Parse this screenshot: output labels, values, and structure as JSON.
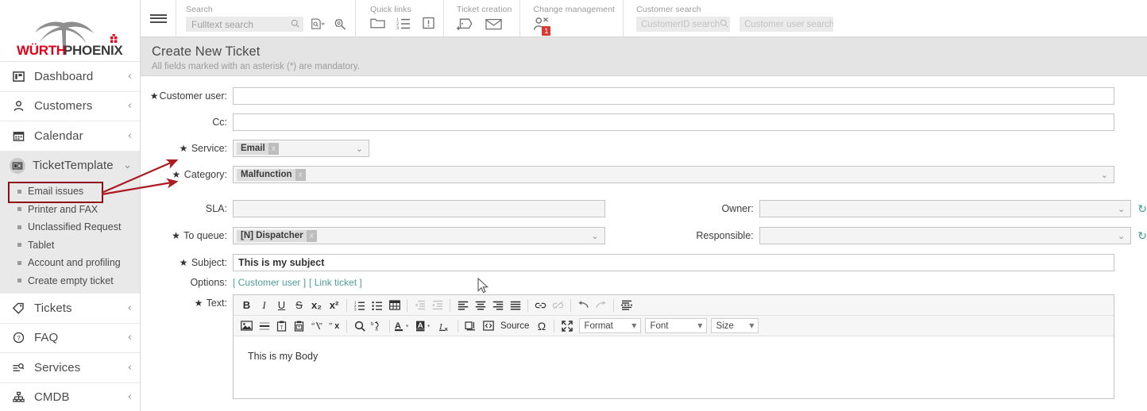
{
  "brand": {
    "name_part1": "WÜRTH",
    "name_part2": "PHOENIX",
    "red": "#e2001a",
    "grey": "#8e8e8e"
  },
  "sidebar": {
    "items": [
      {
        "label": "Dashboard",
        "icon": "dashboard-icon",
        "chevron": "‹"
      },
      {
        "label": "Customers",
        "icon": "user-icon",
        "chevron": "‹"
      },
      {
        "label": "Calendar",
        "icon": "calendar-icon",
        "chevron": "‹"
      },
      {
        "label": "TicketTemplate",
        "icon": "template-icon",
        "chevron": "⌄"
      },
      {
        "label": "Tickets",
        "icon": "tag-icon",
        "chevron": "‹"
      },
      {
        "label": "FAQ",
        "icon": "question-icon",
        "chevron": "‹"
      },
      {
        "label": "Services",
        "icon": "service-search-icon",
        "chevron": "‹"
      },
      {
        "label": "CMDB",
        "icon": "hierarchy-icon",
        "chevron": "‹"
      }
    ],
    "sub_items": [
      {
        "label": "Email issues",
        "highlighted": true
      },
      {
        "label": "Printer and FAX",
        "highlighted": false
      },
      {
        "label": "Unclassified Request",
        "highlighted": false
      },
      {
        "label": "Tablet",
        "highlighted": false
      },
      {
        "label": "Account and profiling",
        "highlighted": false
      },
      {
        "label": "Create empty ticket",
        "highlighted": false
      }
    ],
    "highlight_color": "#8b0f14"
  },
  "toolbar": {
    "menu_icon": "hamburger-icon",
    "search": {
      "title": "Search",
      "placeholder": "Fulltext search",
      "icons": [
        "search-icon",
        "search-document-dropdown-icon",
        "search-advanced-icon"
      ]
    },
    "quick_links": {
      "title": "Quick links",
      "icons": [
        "folder-icon",
        "list-icon",
        "alert-icon"
      ]
    },
    "ticket_creation": {
      "title": "Ticket creation",
      "icons": [
        "ticket-add-icon",
        "email-icon"
      ]
    },
    "change_management": {
      "title": "Change management",
      "icon": "change-user-icon",
      "badge": "1",
      "badge_color": "#d93a34"
    },
    "customer_search": {
      "title": "Customer search",
      "field1_placeholder": "CustomerID search",
      "field2_placeholder": "Customer user search",
      "icon": "search-icon"
    }
  },
  "page": {
    "title": "Create New Ticket",
    "subtitle": "All fields marked with an asterisk (*) are mandatory."
  },
  "form": {
    "star": "★",
    "fields": {
      "customer_user": {
        "label": "Customer user:",
        "required": true,
        "value": ""
      },
      "cc": {
        "label": "Cc:",
        "required": false,
        "value": ""
      },
      "service": {
        "label": "Service:",
        "required": true,
        "tag": "Email",
        "tag_remove": "x"
      },
      "category": {
        "label": "Category:",
        "required": true,
        "tag": "Malfunction",
        "tag_remove": "x"
      },
      "sla": {
        "label": "SLA:",
        "required": false,
        "value": ""
      },
      "to_queue": {
        "label": "To queue:",
        "required": true,
        "tag": "[N] Dispatcher",
        "tag_remove": "x"
      },
      "subject": {
        "label": "Subject:",
        "required": true,
        "value": "This is my subject"
      },
      "options": {
        "label": "Options:",
        "required": false,
        "link1": "[ Customer user ]",
        "link2": "[ Link ticket ]"
      },
      "text": {
        "label": "Text:",
        "required": true,
        "body": "This is my Body"
      },
      "owner": {
        "label": "Owner:",
        "required": false,
        "value": ""
      },
      "responsible": {
        "label": "Responsible:",
        "required": false,
        "value": ""
      }
    },
    "link_color": "#4f9e98",
    "refresh_color": "#3f9a93"
  },
  "editor": {
    "row1": [
      {
        "name": "bold-icon",
        "glyph": "B",
        "style": "bold"
      },
      {
        "name": "italic-icon",
        "glyph": "I",
        "style": "italic"
      },
      {
        "name": "underline-icon",
        "glyph": "U",
        "style": "underline"
      },
      {
        "name": "strikethrough-icon",
        "glyph": "S",
        "style": "strike"
      },
      {
        "name": "subscript-icon",
        "glyph": "x₂",
        "style": "plain"
      },
      {
        "name": "superscript-icon",
        "glyph": "x²",
        "style": "plain"
      },
      {
        "name": "numbered-list-icon",
        "glyph": "svg",
        "style": "plain"
      },
      {
        "name": "bulleted-list-icon",
        "glyph": "svg",
        "style": "plain"
      },
      {
        "name": "table-icon",
        "glyph": "svg",
        "style": "plain"
      },
      {
        "name": "outdent-icon",
        "glyph": "svg",
        "style": "dim"
      },
      {
        "name": "indent-icon",
        "glyph": "svg",
        "style": "dim"
      },
      {
        "name": "align-left-icon",
        "glyph": "svg",
        "style": "plain"
      },
      {
        "name": "align-center-icon",
        "glyph": "svg",
        "style": "plain"
      },
      {
        "name": "align-right-icon",
        "glyph": "svg",
        "style": "plain"
      },
      {
        "name": "align-justify-icon",
        "glyph": "svg",
        "style": "plain"
      },
      {
        "name": "link-icon",
        "glyph": "svg",
        "style": "plain"
      },
      {
        "name": "unlink-icon",
        "glyph": "svg",
        "style": "dim"
      },
      {
        "name": "undo-icon",
        "glyph": "svg",
        "style": "plain"
      },
      {
        "name": "redo-icon",
        "glyph": "svg",
        "style": "dim"
      },
      {
        "name": "page-break-icon",
        "glyph": "svg",
        "style": "plain"
      }
    ],
    "row2": [
      {
        "name": "image-icon",
        "glyph": "svg"
      },
      {
        "name": "horizontal-rule-icon",
        "glyph": "svg"
      },
      {
        "name": "paste-as-text-icon",
        "glyph": "svg"
      },
      {
        "name": "paste-from-word-icon",
        "glyph": "svg"
      },
      {
        "name": "show-blocks-icon",
        "glyph": "svg"
      },
      {
        "name": "remove-quote-icon",
        "glyph": "svg"
      },
      {
        "name": "find-icon",
        "glyph": "svg"
      },
      {
        "name": "replace-icon",
        "glyph": "svg"
      },
      {
        "name": "text-color-icon",
        "glyph": "svg"
      },
      {
        "name": "background-color-icon",
        "glyph": "svg"
      },
      {
        "name": "remove-format-icon",
        "glyph": "svg"
      },
      {
        "name": "spell-check-icon",
        "glyph": "svg"
      },
      {
        "name": "source-icon",
        "glyph": "svg"
      },
      {
        "name": "special-character-icon",
        "glyph": "Ω"
      },
      {
        "name": "maximize-icon",
        "glyph": "svg"
      }
    ],
    "source_label": "Source",
    "dropdowns": [
      {
        "name": "format-dropdown",
        "label": "Format",
        "width": 78
      },
      {
        "name": "font-dropdown",
        "label": "Font",
        "width": 78
      },
      {
        "name": "size-dropdown",
        "label": "Size",
        "width": 60
      }
    ]
  },
  "annotations": {
    "arrow_color": "#aa1c22",
    "arrow1_target": "service-field",
    "arrow2_target": "category-field"
  }
}
